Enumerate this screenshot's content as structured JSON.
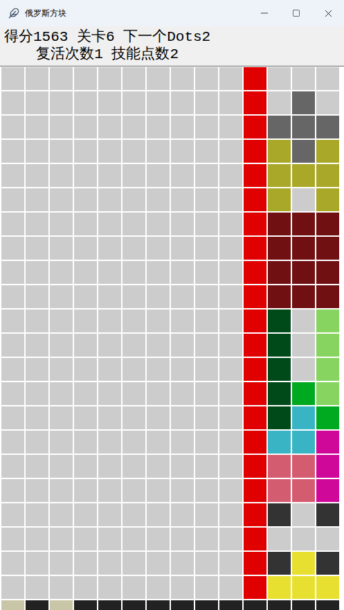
{
  "window": {
    "title": "俄罗斯方块"
  },
  "status": {
    "line1": "得分1563 关卡6 下一个Dots2",
    "line2": "复活次数1 技能点数2"
  },
  "board": {
    "rows": [
      [
        "#cccccc",
        "#cccccc",
        "#cccccc",
        "#cccccc",
        "#cccccc",
        "#cccccc",
        "#cccccc",
        "#cccccc",
        "#cccccc",
        "#cccccc",
        "#e00000",
        "#cccccc",
        "#cccccc",
        "#cccccc"
      ],
      [
        "#cccccc",
        "#cccccc",
        "#cccccc",
        "#cccccc",
        "#cccccc",
        "#cccccc",
        "#cccccc",
        "#cccccc",
        "#cccccc",
        "#cccccc",
        "#e00000",
        "#cccccc",
        "#666666",
        "#cccccc"
      ],
      [
        "#cccccc",
        "#cccccc",
        "#cccccc",
        "#cccccc",
        "#cccccc",
        "#cccccc",
        "#cccccc",
        "#cccccc",
        "#cccccc",
        "#cccccc",
        "#e00000",
        "#666666",
        "#666666",
        "#666666"
      ],
      [
        "#cccccc",
        "#cccccc",
        "#cccccc",
        "#cccccc",
        "#cccccc",
        "#cccccc",
        "#cccccc",
        "#cccccc",
        "#cccccc",
        "#cccccc",
        "#e00000",
        "#aaa828",
        "#666666",
        "#aaa828"
      ],
      [
        "#cccccc",
        "#cccccc",
        "#cccccc",
        "#cccccc",
        "#cccccc",
        "#cccccc",
        "#cccccc",
        "#cccccc",
        "#cccccc",
        "#cccccc",
        "#e00000",
        "#aaa828",
        "#aaa828",
        "#aaa828"
      ],
      [
        "#cccccc",
        "#cccccc",
        "#cccccc",
        "#cccccc",
        "#cccccc",
        "#cccccc",
        "#cccccc",
        "#cccccc",
        "#cccccc",
        "#cccccc",
        "#e00000",
        "#aaa828",
        "#cccccc",
        "#aaa828"
      ],
      [
        "#cccccc",
        "#cccccc",
        "#cccccc",
        "#cccccc",
        "#cccccc",
        "#cccccc",
        "#cccccc",
        "#cccccc",
        "#cccccc",
        "#cccccc",
        "#e00000",
        "#701012",
        "#701012",
        "#701012"
      ],
      [
        "#cccccc",
        "#cccccc",
        "#cccccc",
        "#cccccc",
        "#cccccc",
        "#cccccc",
        "#cccccc",
        "#cccccc",
        "#cccccc",
        "#cccccc",
        "#e00000",
        "#701012",
        "#701012",
        "#701012"
      ],
      [
        "#cccccc",
        "#cccccc",
        "#cccccc",
        "#cccccc",
        "#cccccc",
        "#cccccc",
        "#cccccc",
        "#cccccc",
        "#cccccc",
        "#cccccc",
        "#e00000",
        "#701012",
        "#701012",
        "#701012"
      ],
      [
        "#cccccc",
        "#cccccc",
        "#cccccc",
        "#cccccc",
        "#cccccc",
        "#cccccc",
        "#cccccc",
        "#cccccc",
        "#cccccc",
        "#cccccc",
        "#e00000",
        "#701012",
        "#701012",
        "#701012"
      ],
      [
        "#cccccc",
        "#cccccc",
        "#cccccc",
        "#cccccc",
        "#cccccc",
        "#cccccc",
        "#cccccc",
        "#cccccc",
        "#cccccc",
        "#cccccc",
        "#e00000",
        "#004a1a",
        "#cccccc",
        "#88d460"
      ],
      [
        "#cccccc",
        "#cccccc",
        "#cccccc",
        "#cccccc",
        "#cccccc",
        "#cccccc",
        "#cccccc",
        "#cccccc",
        "#cccccc",
        "#cccccc",
        "#e00000",
        "#004a1a",
        "#cccccc",
        "#88d460"
      ],
      [
        "#cccccc",
        "#cccccc",
        "#cccccc",
        "#cccccc",
        "#cccccc",
        "#cccccc",
        "#cccccc",
        "#cccccc",
        "#cccccc",
        "#cccccc",
        "#e00000",
        "#004a1a",
        "#cccccc",
        "#88d460"
      ],
      [
        "#cccccc",
        "#cccccc",
        "#cccccc",
        "#cccccc",
        "#cccccc",
        "#cccccc",
        "#cccccc",
        "#cccccc",
        "#cccccc",
        "#cccccc",
        "#e00000",
        "#004a1a",
        "#00aa20",
        "#88d460"
      ],
      [
        "#cccccc",
        "#cccccc",
        "#cccccc",
        "#cccccc",
        "#cccccc",
        "#cccccc",
        "#cccccc",
        "#cccccc",
        "#cccccc",
        "#cccccc",
        "#e00000",
        "#004a1a",
        "#38b4c4",
        "#00aa20"
      ],
      [
        "#cccccc",
        "#cccccc",
        "#cccccc",
        "#cccccc",
        "#cccccc",
        "#cccccc",
        "#cccccc",
        "#cccccc",
        "#cccccc",
        "#cccccc",
        "#e00000",
        "#38b4c4",
        "#38b4c4",
        "#d0089a"
      ],
      [
        "#cccccc",
        "#cccccc",
        "#cccccc",
        "#cccccc",
        "#cccccc",
        "#cccccc",
        "#cccccc",
        "#cccccc",
        "#cccccc",
        "#cccccc",
        "#e00000",
        "#d45c70",
        "#d45c70",
        "#d0089a"
      ],
      [
        "#cccccc",
        "#cccccc",
        "#cccccc",
        "#cccccc",
        "#cccccc",
        "#cccccc",
        "#cccccc",
        "#cccccc",
        "#cccccc",
        "#cccccc",
        "#e00000",
        "#d45c70",
        "#d45c70",
        "#d0089a"
      ],
      [
        "#cccccc",
        "#cccccc",
        "#cccccc",
        "#cccccc",
        "#cccccc",
        "#cccccc",
        "#cccccc",
        "#cccccc",
        "#cccccc",
        "#cccccc",
        "#e00000",
        "#333333",
        "#cccccc",
        "#333333"
      ],
      [
        "#cccccc",
        "#cccccc",
        "#cccccc",
        "#cccccc",
        "#cccccc",
        "#cccccc",
        "#cccccc",
        "#cccccc",
        "#cccccc",
        "#cccccc",
        "#e00000",
        "#cccccc",
        "#cccccc",
        "#cccccc"
      ],
      [
        "#cccccc",
        "#cccccc",
        "#cccccc",
        "#cccccc",
        "#cccccc",
        "#cccccc",
        "#cccccc",
        "#cccccc",
        "#cccccc",
        "#cccccc",
        "#e00000",
        "#333333",
        "#e8e030",
        "#333333"
      ],
      [
        "#cccccc",
        "#cccccc",
        "#cccccc",
        "#cccccc",
        "#cccccc",
        "#cccccc",
        "#cccccc",
        "#cccccc",
        "#cccccc",
        "#cccccc",
        "#e00000",
        "#e8e030",
        "#e8e030",
        "#e8e030"
      ],
      [
        "#c8c6a6",
        "#222222",
        "#c8c6a6",
        "#222222",
        "#222222",
        "#222222",
        "#222222",
        "#222222",
        "#222222",
        "#222222",
        "#222222",
        "#222222",
        "#222222",
        "#222222"
      ]
    ]
  }
}
